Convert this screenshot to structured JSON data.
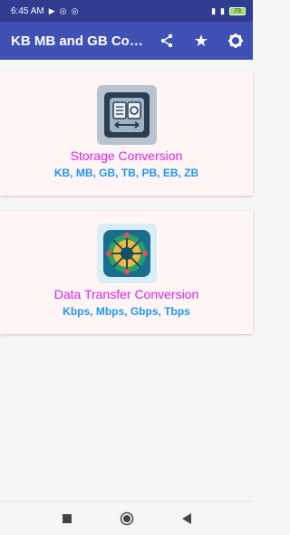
{
  "status_bar": {
    "time": "6:45 AM",
    "battery": "73"
  },
  "app_bar": {
    "title": "KB MB and GB Con..."
  },
  "cards": [
    {
      "title": "Storage Conversion",
      "subtitle": "KB, MB, GB, TB, PB, EB, ZB",
      "icon": "storage-icon"
    },
    {
      "title": "Data Transfer Conversion",
      "subtitle": "Kbps, Mbps, Gbps, Tbps",
      "icon": "network-icon"
    }
  ],
  "colors": {
    "title": "#e020e8",
    "subtitle": "#2196f3",
    "appbar": "#3f51b5",
    "statusbar": "#2f3c8f"
  }
}
